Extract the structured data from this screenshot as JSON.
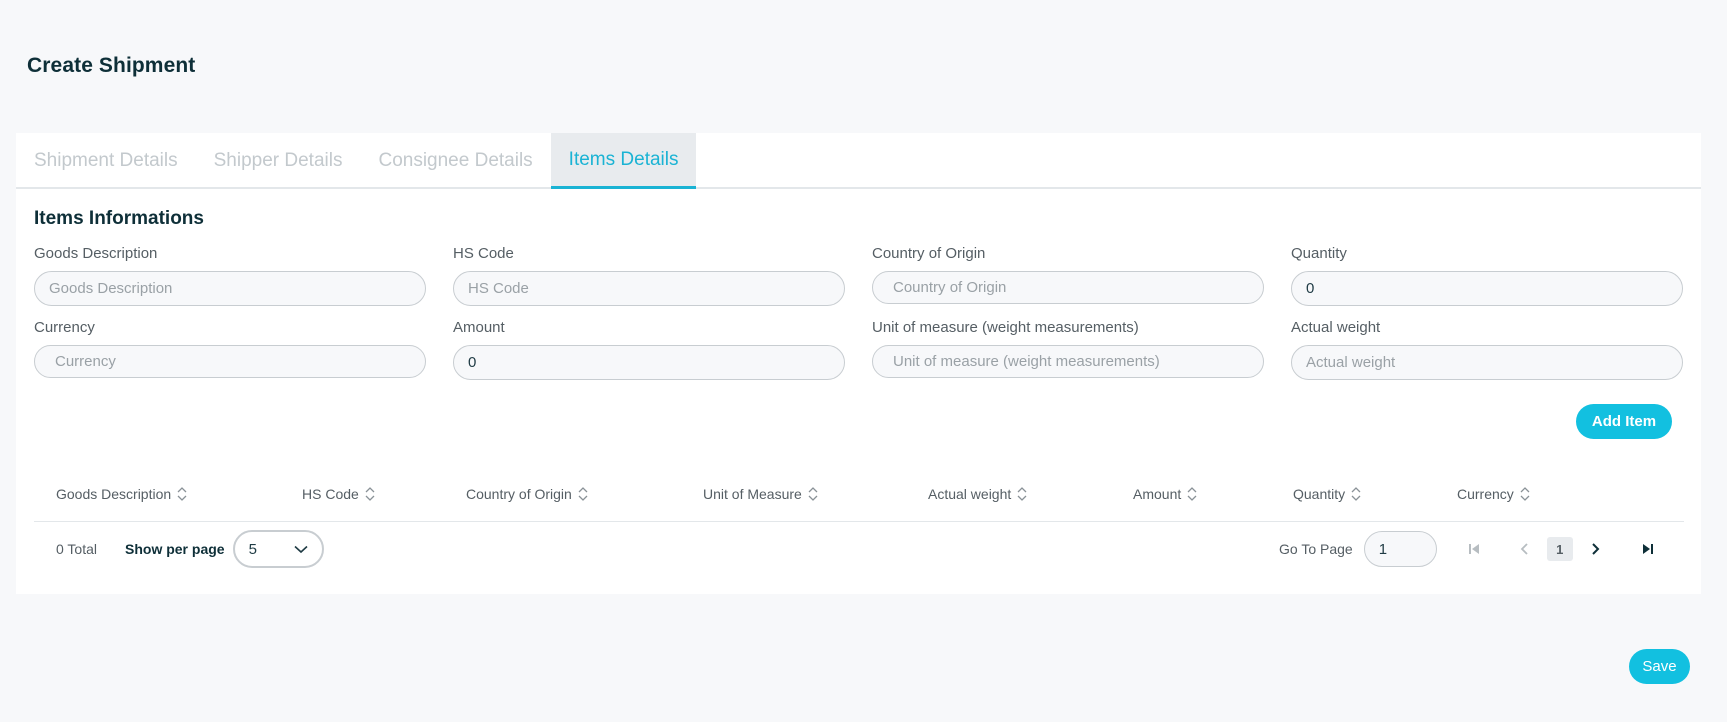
{
  "page": {
    "title": "Create Shipment"
  },
  "tabs": [
    {
      "label": "Shipment Details",
      "active": false
    },
    {
      "label": "Shipper Details",
      "active": false
    },
    {
      "label": "Consignee Details",
      "active": false
    },
    {
      "label": "Items Details",
      "active": true
    }
  ],
  "section": {
    "title": "Items Informations"
  },
  "form": {
    "goods_description": {
      "label": "Goods Description",
      "placeholder": "Goods Description",
      "value": ""
    },
    "hs_code": {
      "label": "HS Code",
      "placeholder": "HS Code",
      "value": ""
    },
    "country_of_origin": {
      "label": "Country of Origin",
      "placeholder": "Country of Origin",
      "value": ""
    },
    "quantity": {
      "label": "Quantity",
      "placeholder": "",
      "value": "0"
    },
    "currency": {
      "label": "Currency",
      "placeholder": "Currency",
      "value": ""
    },
    "amount": {
      "label": "Amount",
      "placeholder": "",
      "value": "0"
    },
    "unit_of_measure": {
      "label": "Unit of measure (weight measurements)",
      "placeholder": "Unit of measure (weight measurements)",
      "value": ""
    },
    "actual_weight": {
      "label": "Actual weight",
      "placeholder": "Actual weight",
      "value": ""
    }
  },
  "buttons": {
    "add_item": "Add Item",
    "save": "Save"
  },
  "table": {
    "columns": [
      "Goods Description",
      "HS Code",
      "Country of Origin",
      "Unit of Measure",
      "Actual weight",
      "Amount",
      "Quantity",
      "Currency"
    ],
    "rows": []
  },
  "pagination": {
    "total": "0 Total",
    "per_page_label": "Show per page",
    "per_page_value": "5",
    "go_to_label": "Go To Page",
    "go_to_value": "1",
    "current_page": "1"
  },
  "colors": {
    "accent": "#12c0e0",
    "tab_active": "#1ab3d4",
    "heading": "#0e2f38"
  }
}
